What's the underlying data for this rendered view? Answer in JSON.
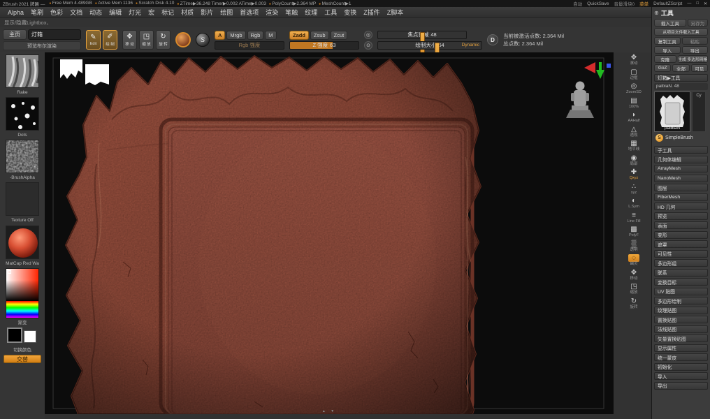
{
  "titlebar": {
    "title": "ZBrush 2021 牌匾 —",
    "stats": [
      "Free Mem 4.489GB",
      "Active Mem 1136",
      "Scratch Disk 4.10",
      "ZTime▶36.248 Timer▶0.002 ATime▶0.003",
      "PolyCount▶2.364 MP",
      "MeshCount▶1"
    ],
    "auto": "自动",
    "quicksave": "QuickSave",
    "volume": "音量滑块0",
    "menu": "菜单",
    "zscript": "DefaultZScript",
    "win_min": "—",
    "win_max": "□",
    "win_close": "✕"
  },
  "menubar": {
    "items": [
      "Alpha",
      "笔刷",
      "色彩",
      "文档",
      "动态",
      "编辑",
      "灯光",
      "宏",
      "标记",
      "材质",
      "影片",
      "绘图",
      "首选项",
      "渲染",
      "笔触",
      "纹理",
      "工具",
      "变换",
      "Z插件",
      "Z脚本"
    ]
  },
  "statusline": {
    "text": "显示/隐藏Lightbox、"
  },
  "icons": {
    "edit": "✎",
    "draw": "✐",
    "move": "✥",
    "scale": "◳",
    "rotate": "↻",
    "material_s": "S",
    "focal": "◎",
    "size": "⊙",
    "dynamic": "D",
    "panel_zoom": "⊕"
  },
  "shelf": {
    "home": "主页",
    "lightbox": "灯箱",
    "preview_boolean": "预览布尔渲染",
    "edit_label": "Edit",
    "draw_label": "绘 制",
    "move_label": "移 动",
    "scale_label": "缩 放",
    "rotate_label": "旋 转",
    "a": "A",
    "mrgb": "Mrgb",
    "rgb": "Rgb",
    "m": "M",
    "rgb_slider": "Rgb 强度",
    "zadd": "Zadd",
    "zsub": "Zsub",
    "zcut": "Zcut",
    "z_slider": "Z 强度",
    "z_value": "63",
    "focal_label": "焦点衰减",
    "focal_value": "48",
    "draw_size_label": "绘制大小",
    "draw_size_value": "64",
    "dynamic": "Dynamic",
    "points_active": "当前被激活点数: 2.364 Mil",
    "points_total": "总点数: 2.364 Mil"
  },
  "left_sidebar": {
    "brush": "Rake",
    "stroke": "Dots",
    "alpha": "-BrushAlpha",
    "texture": "Texture Off",
    "material": "MatCap Red Wa",
    "gradient": "渐变",
    "swap": "切换颜色",
    "alt": "交替"
  },
  "canvas": {
    "nav_up": "▲",
    "nav_down": "▼"
  },
  "right_strip": {
    "items": [
      {
        "glyph": "✥",
        "label": "滚动"
      },
      {
        "glyph": "▢",
        "label": "边框"
      },
      {
        "glyph": "◎",
        "label": "ZoomSD"
      },
      {
        "glyph": "▤",
        "label": "100%"
      },
      {
        "glyph": "◗",
        "label": "AAHalf"
      },
      {
        "glyph": "△",
        "label": "透视"
      },
      {
        "glyph": "▦",
        "label": "地平线"
      },
      {
        "glyph": "◉",
        "label": "局部"
      },
      {
        "glyph": "✚",
        "label": "Qxyz",
        "cls": "orange"
      },
      {
        "glyph": "∴",
        "label": "xyz"
      },
      {
        "glyph": "◐",
        "label": "L.Sym"
      },
      {
        "glyph": "≡",
        "label": "Line Fill"
      },
      {
        "glyph": "▩",
        "label": "PolyF"
      },
      {
        "glyph": "▒",
        "label": "透明"
      },
      {
        "glyph": "◌",
        "label": "幽灵",
        "cls": "active"
      },
      {
        "glyph": "✥",
        "label": "移动"
      },
      {
        "glyph": "◳",
        "label": "缩放"
      },
      {
        "glyph": "↻",
        "label": "旋转"
      }
    ]
  },
  "tool_panel": {
    "header": "工具",
    "load": "载入工具",
    "save_as": "另存为",
    "load_project": "从项目文件载入工具",
    "copy": "复制工具",
    "paste": "粘贴",
    "import": "导入",
    "export": "导出",
    "clone": "克隆",
    "make_polymesh": "生成 多边形网格",
    "goz": "GoZ",
    "all": "全部",
    "visible": "可见",
    "lightbox_tool": "灯箱▶工具",
    "active_item": "paibiaN. 48",
    "thumb_label": "paibiaN",
    "thumb2_label": "Cy",
    "simplebrush": "SimpleBrush",
    "sections": [
      "子工具",
      "几何体编辑",
      "ArrayMesh",
      "NanoMesh",
      "图层",
      "FiberMesh",
      "HD 几何",
      "预览",
      "表面",
      "变形",
      "遮罩",
      "可见性",
      "多边形组",
      "联系",
      "变换目标",
      "UV 贴图",
      "多边形绘制",
      "纹理贴图",
      "置换贴图",
      "法线贴图",
      "矢量置换贴图",
      "显示属性",
      "统一蒙皮",
      "初始化",
      "导入",
      "导出"
    ]
  }
}
